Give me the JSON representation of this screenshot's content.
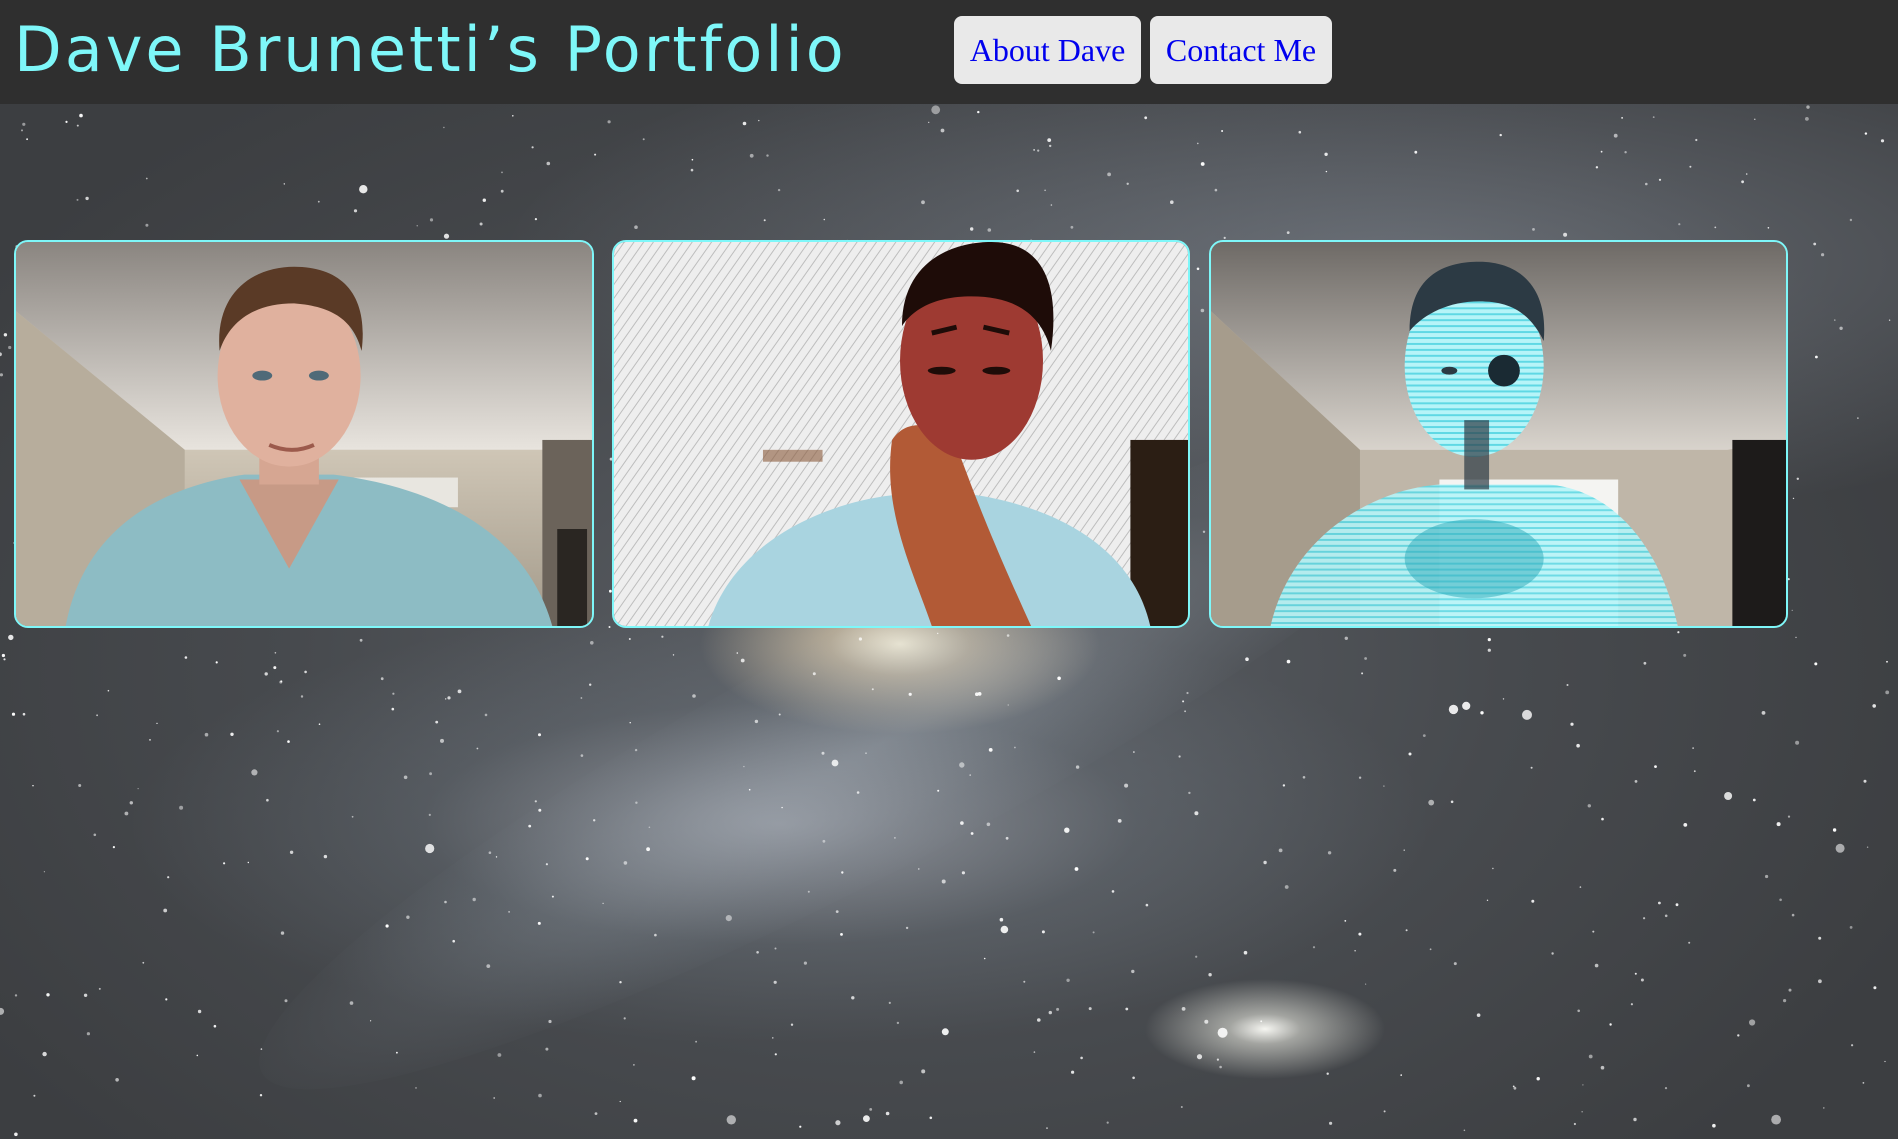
{
  "header": {
    "title": "Dave Brunetti’s Portfolio",
    "nav": {
      "about_label": "About Dave",
      "contact_label": "Contact Me"
    }
  },
  "gallery": {
    "photos": [
      {
        "style": "normal"
      },
      {
        "style": "sketch"
      },
      {
        "style": "hologram"
      }
    ]
  },
  "colors": {
    "accent": "#7ef7f9",
    "header_bg": "#2f2f2f",
    "button_bg": "#e9e9e9",
    "link": "#0000ee"
  }
}
